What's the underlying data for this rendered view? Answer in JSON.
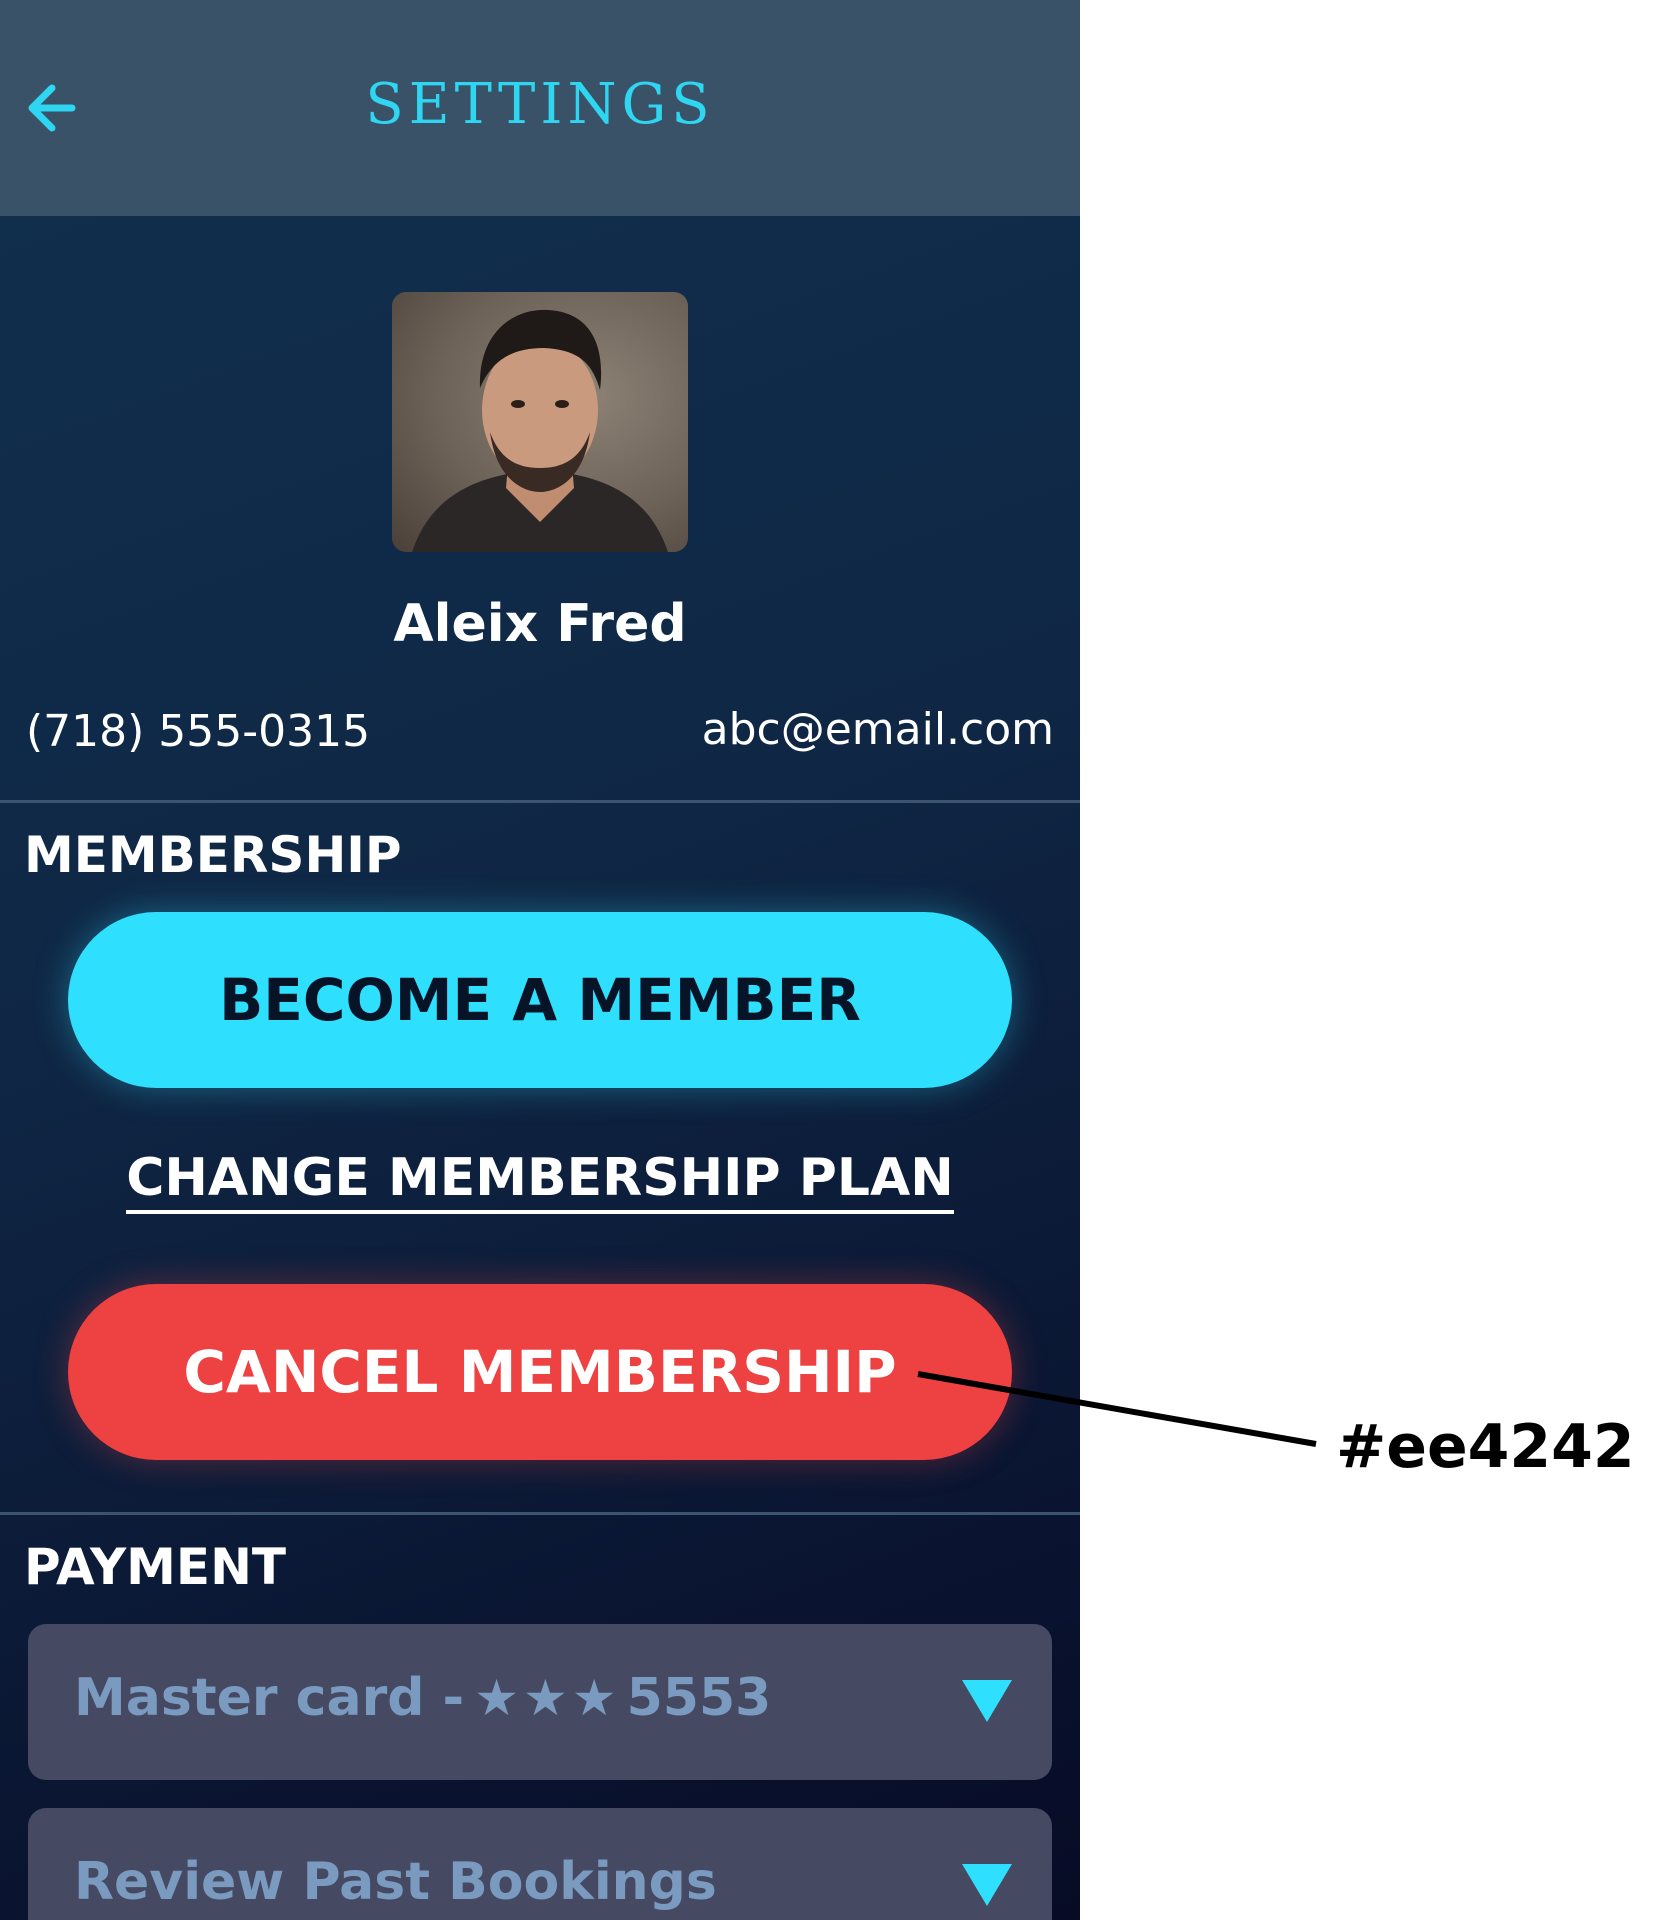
{
  "header": {
    "title": "SETTINGS",
    "back_icon": "back-arrow-icon"
  },
  "profile": {
    "name": "Aleix Fred",
    "phone": "(718) 555-0315",
    "email": "abc@email.com"
  },
  "membership": {
    "label": "MEMBERSHIP",
    "become_label": "BECOME A MEMBER",
    "change_label": "CHANGE MEMBERSHIP PLAN",
    "cancel_label": "CANCEL MEMBERSHIP"
  },
  "payment": {
    "label": "PAYMENT",
    "card_prefix": "Master card -",
    "card_suffix": "5553",
    "review_label": "Review Past Bookings"
  },
  "annotation": {
    "color_label": "#ee4242"
  },
  "colors": {
    "accent": "#2ee0fd",
    "danger": "#ee4242",
    "header_bg": "#3a5268"
  }
}
